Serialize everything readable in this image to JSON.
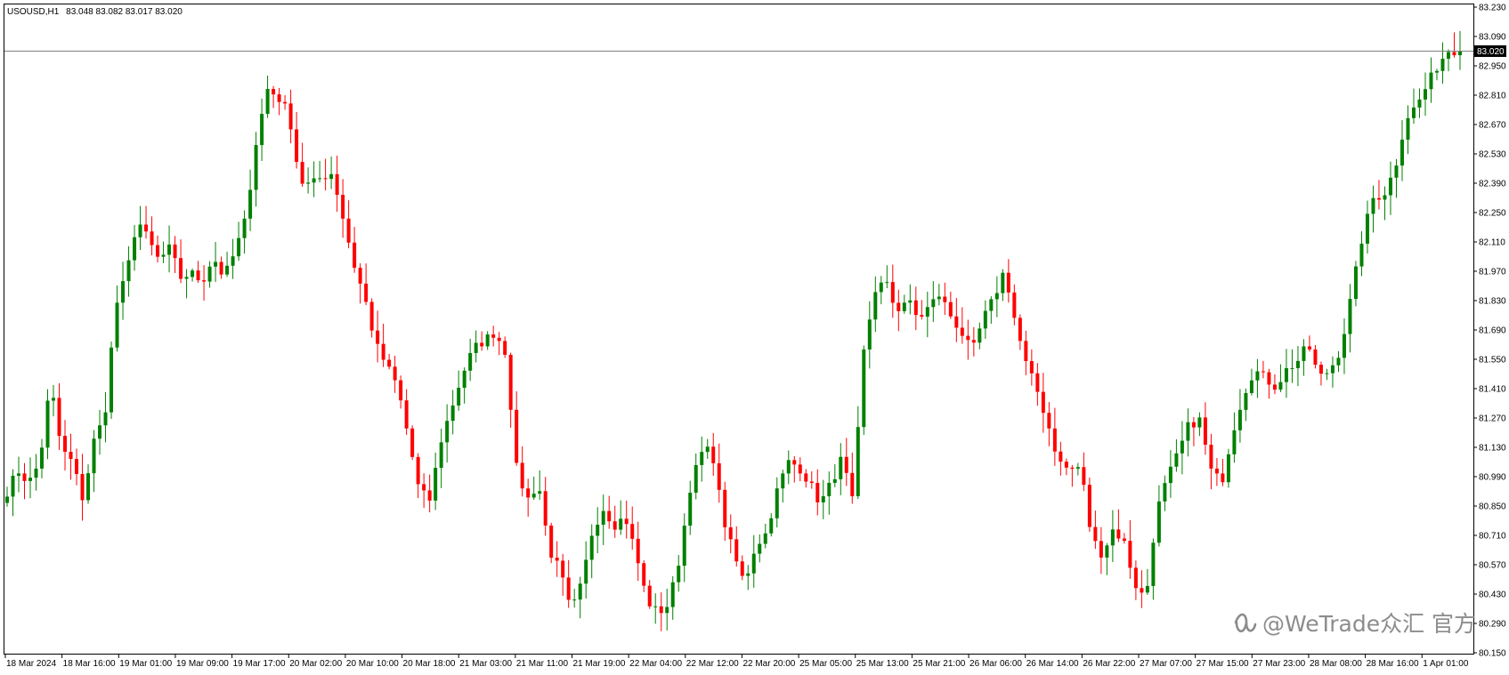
{
  "header": {
    "symbol_label": "USOUSD,H1",
    "ohlc_label": "83.048 83.082 83.017 83.020"
  },
  "watermark": {
    "text": "@WeTrade众汇 官方",
    "icon": "wechat-video-icon"
  },
  "current_price": {
    "value": 83.02,
    "label": "83.020"
  },
  "colors": {
    "bull": "#008000",
    "bear": "#ff0000",
    "background": "#ffffff",
    "axis": "#000000",
    "price_line": "#808080",
    "price_tag_bg": "#000000",
    "price_tag_text": "#ffffff"
  },
  "chart_data": {
    "type": "candlestick",
    "timeframe": "H1",
    "grid": false,
    "ylim": [
      80.15,
      83.23
    ],
    "y_ticks": [
      "83.230",
      "83.090",
      "82.950",
      "82.810",
      "82.670",
      "82.530",
      "82.390",
      "82.250",
      "82.110",
      "81.970",
      "81.830",
      "81.690",
      "81.550",
      "81.410",
      "81.270",
      "81.130",
      "80.990",
      "80.850",
      "80.710",
      "80.570",
      "80.430",
      "80.290",
      "80.150"
    ],
    "x_ticks": [
      "18 Mar 2024",
      "18 Mar 16:00",
      "19 Mar 01:00",
      "19 Mar 09:00",
      "19 Mar 17:00",
      "20 Mar 02:00",
      "20 Mar 10:00",
      "20 Mar 18:00",
      "21 Mar 03:00",
      "21 Mar 11:00",
      "21 Mar 19:00",
      "22 Mar 04:00",
      "22 Mar 12:00",
      "22 Mar 20:00",
      "25 Mar 05:00",
      "25 Mar 13:00",
      "25 Mar 21:00",
      "26 Mar 06:00",
      "26 Mar 14:00",
      "26 Mar 22:00",
      "27 Mar 07:00",
      "27 Mar 15:00",
      "27 Mar 23:00",
      "28 Mar 08:00",
      "28 Mar 16:00",
      "1 Apr 01:00"
    ],
    "close_path": [
      80.92,
      81.02,
      80.96,
      81.06,
      81.44,
      81.12,
      81.06,
      80.88,
      81.16,
      81.28,
      81.8,
      81.95,
      82.22,
      82.12,
      82.02,
      82.08,
      81.94,
      81.96,
      81.92,
      82.04,
      81.94,
      82.06,
      82.22,
      82.6,
      82.84,
      82.8,
      82.72,
      82.4,
      82.38,
      82.42,
      82.44,
      82.22,
      82.0,
      81.84,
      81.62,
      81.52,
      81.42,
      81.18,
      80.92,
      80.88,
      81.16,
      81.32,
      81.48,
      81.6,
      81.64,
      81.68,
      81.58,
      81.02,
      80.88,
      80.96,
      80.64,
      80.54,
      80.34,
      80.48,
      80.74,
      80.84,
      80.76,
      80.8,
      80.62,
      80.4,
      80.34,
      80.38,
      80.6,
      80.94,
      81.1,
      81.12,
      80.8,
      80.62,
      80.48,
      80.66,
      80.72,
      80.92,
      81.06,
      81.04,
      80.96,
      80.86,
      80.96,
      81.08,
      80.86,
      81.58,
      81.88,
      81.92,
      81.78,
      81.84,
      81.74,
      81.8,
      81.86,
      81.76,
      81.68,
      81.58,
      81.74,
      81.84,
      81.98,
      81.72,
      81.52,
      81.4,
      81.24,
      81.06,
      81.02,
      81.04,
      80.7,
      80.62,
      80.74,
      80.68,
      80.48,
      80.4,
      80.82,
      80.98,
      81.1,
      81.24,
      81.26,
      81.02,
      80.96,
      81.2,
      81.38,
      81.5,
      81.46,
      81.42,
      81.5,
      81.54,
      81.62,
      81.46,
      81.5,
      81.6,
      81.86,
      82.14,
      82.32,
      82.34,
      82.46,
      82.7,
      82.76,
      82.86,
      82.96,
      83.03,
      83.02
    ]
  }
}
